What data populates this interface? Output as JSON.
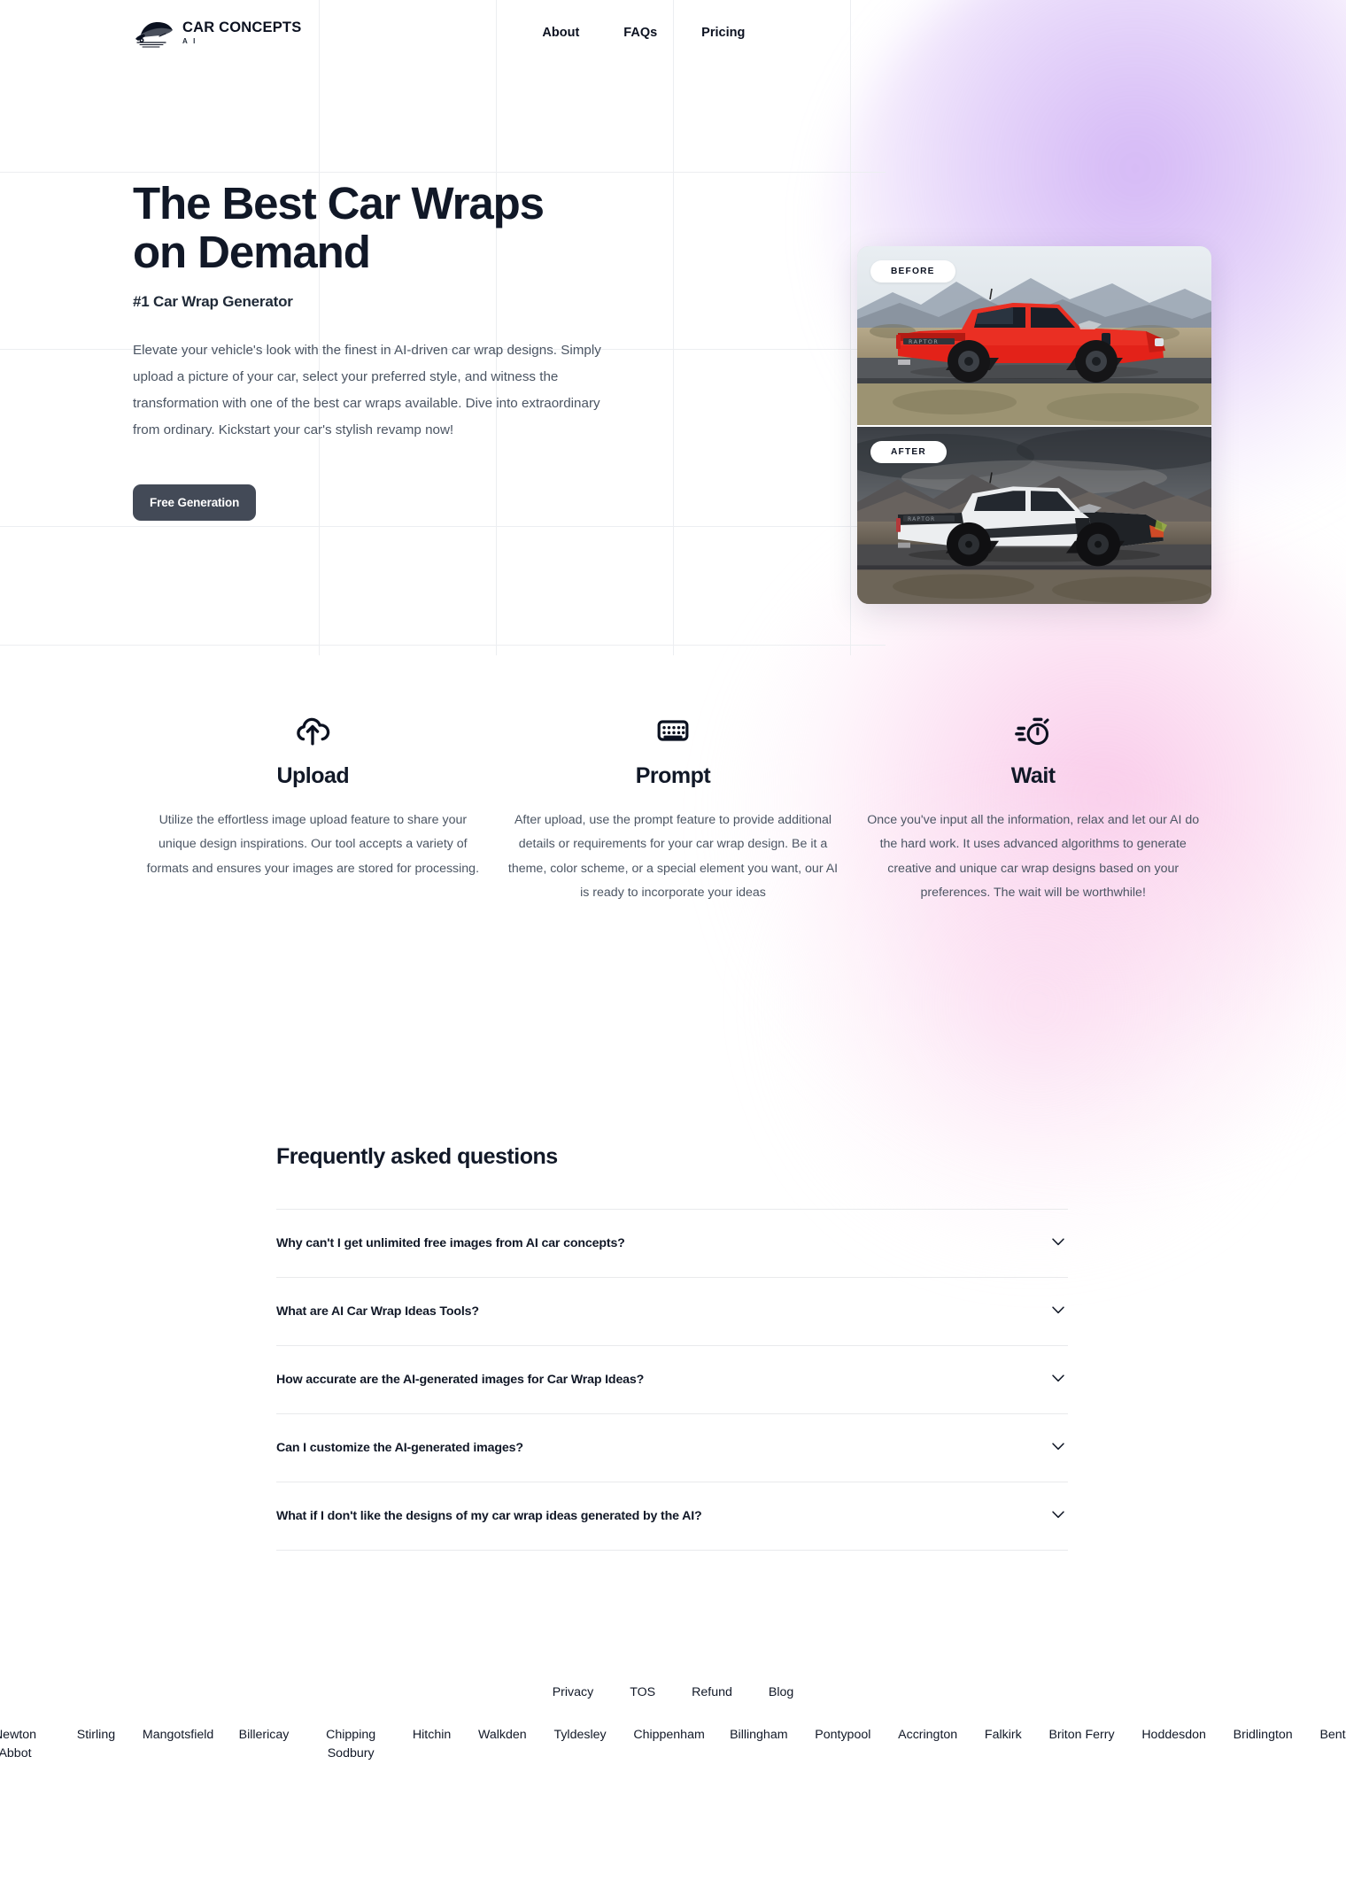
{
  "brand": {
    "name": "CAR CONCEPTS",
    "sub": "A I",
    "logo_icon": "car-logo-icon"
  },
  "nav": {
    "items": [
      {
        "label": "About"
      },
      {
        "label": "FAQs"
      },
      {
        "label": "Pricing"
      }
    ]
  },
  "hero": {
    "title": "The Best Car Wraps on Demand",
    "subtitle": "#1 Car Wrap Generator",
    "description": "Elevate your vehicle's look with the finest in AI-driven car wrap designs. Simply upload a picture of your car, select your preferred style, and witness the transformation with one of the best car wraps available. Dive into extraordinary from ordinary. Kickstart your car's stylish revamp now!",
    "cta_label": "Free Generation",
    "before_badge": "BEFORE",
    "after_badge": "AFTER"
  },
  "features": [
    {
      "icon": "cloud-upload-icon",
      "title": "Upload",
      "desc": "Utilize the effortless image upload feature to share your unique design inspirations. Our tool accepts a variety of formats and ensures your images are stored for processing."
    },
    {
      "icon": "keyboard-icon",
      "title": "Prompt",
      "desc": "After upload, use the prompt feature to provide additional details or requirements for your car wrap design. Be it a theme, color scheme, or a special element you want, our AI is ready to incorporate your ideas"
    },
    {
      "icon": "stopwatch-icon",
      "title": "Wait",
      "desc": "Once you've input all the information, relax and let our AI do the hard work. It uses advanced algorithms to generate creative and unique car wrap designs based on your preferences. The wait will be worthwhile!"
    }
  ],
  "faq": {
    "title": "Frequently asked questions",
    "items": [
      {
        "question": "Why can't I get unlimited free images from AI car concepts?",
        "chevron": "chevron-down-icon"
      },
      {
        "question": "What are AI Car Wrap Ideas Tools?",
        "chevron": "chevron-down-icon"
      },
      {
        "question": "How accurate are the AI-generated images for Car Wrap Ideas?",
        "chevron": "chevron-down-icon"
      },
      {
        "question": "Can I customize the AI-generated images?",
        "chevron": "chevron-down-icon"
      },
      {
        "question": "What if I don't like the designs of my car wrap ideas generated by the AI?",
        "chevron": "chevron-down-icon"
      }
    ]
  },
  "footer": {
    "links": [
      {
        "label": "Privacy"
      },
      {
        "label": "TOS"
      },
      {
        "label": "Refund"
      },
      {
        "label": "Blog"
      }
    ],
    "cities": [
      {
        "label": "Newton Abbot"
      },
      {
        "label": "Stirling"
      },
      {
        "label": "Mangotsfield"
      },
      {
        "label": "Billericay"
      },
      {
        "label": "Chipping Sodbury"
      },
      {
        "label": "Hitchin"
      },
      {
        "label": "Walkden"
      },
      {
        "label": "Tyldesley"
      },
      {
        "label": "Chippenham"
      },
      {
        "label": "Billingham"
      },
      {
        "label": "Pontypool"
      },
      {
        "label": "Accrington"
      },
      {
        "label": "Falkirk"
      },
      {
        "label": "Briton Ferry"
      },
      {
        "label": "Hoddesdon"
      },
      {
        "label": "Bridlington"
      },
      {
        "label": "Bentley"
      }
    ]
  },
  "colors": {
    "text_dark": "#111827",
    "text_muted": "#4b5563",
    "button_bg": "#434a57",
    "accent_purple": "#ba8cf0",
    "accent_pink": "#f7b5e1"
  }
}
